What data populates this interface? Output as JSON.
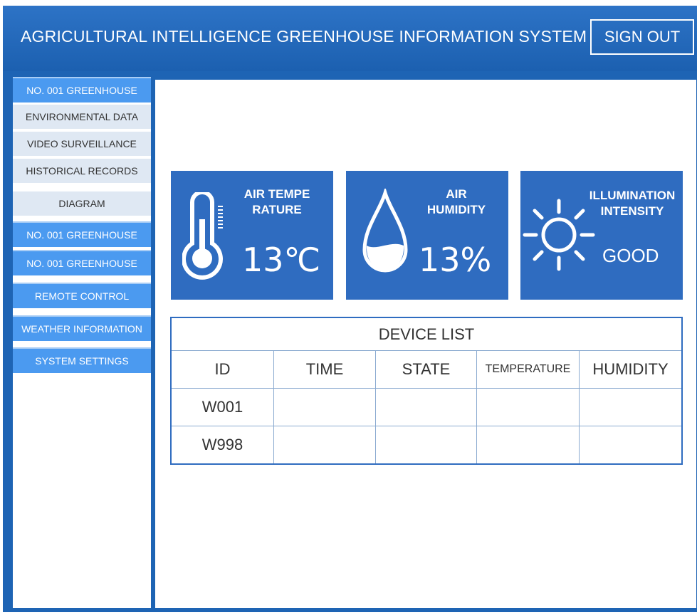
{
  "header": {
    "title": "AGRICULTURAL INTELLIGENCE GREENHOUSE INFORMATION SYSTEM",
    "sign_out": "SIGN OUT"
  },
  "sidebar": {
    "items": [
      {
        "label": "NO. 001 GREENHOUSE",
        "style": "blue"
      },
      {
        "label": "ENVIRONMENTAL DATA",
        "style": "light"
      },
      {
        "label": "VIDEO SURVEILLANCE",
        "style": "light"
      },
      {
        "label": "HISTORICAL RECORDS",
        "style": "light"
      },
      {
        "label": "DIAGRAM",
        "style": "light"
      },
      {
        "label": "NO. 001 GREENHOUSE",
        "style": "blue"
      },
      {
        "label": "NO. 001 GREENHOUSE",
        "style": "blue"
      },
      {
        "label": "REMOTE CONTROL",
        "style": "blue"
      },
      {
        "label": "WEATHER INFORMATION",
        "style": "blue"
      },
      {
        "label": "SYSTEM SETTINGS",
        "style": "blue"
      }
    ]
  },
  "cards": [
    {
      "label": "AIR TEMPE\nRATURE",
      "value": "13℃",
      "icon": "thermometer-icon"
    },
    {
      "label": "AIR\nHUMIDITY",
      "value": "13%",
      "icon": "water-drop-icon"
    },
    {
      "label": "ILLUMINATION\nINTENSITY",
      "value": "GOOD",
      "icon": "sun-icon"
    }
  ],
  "device_list": {
    "title": "DEVICE LIST",
    "columns": [
      "ID",
      "TIME",
      "STATE",
      "TEMPERATURE",
      "HUMIDITY"
    ],
    "rows": [
      [
        "W001",
        "",
        "",
        "",
        ""
      ],
      [
        "W998",
        "",
        "",
        "",
        ""
      ]
    ]
  },
  "colors": {
    "header": "#1e64b4",
    "nav_active": "#4b9af0",
    "nav_light": "#dfe8f3",
    "card": "#2f6cc0"
  }
}
